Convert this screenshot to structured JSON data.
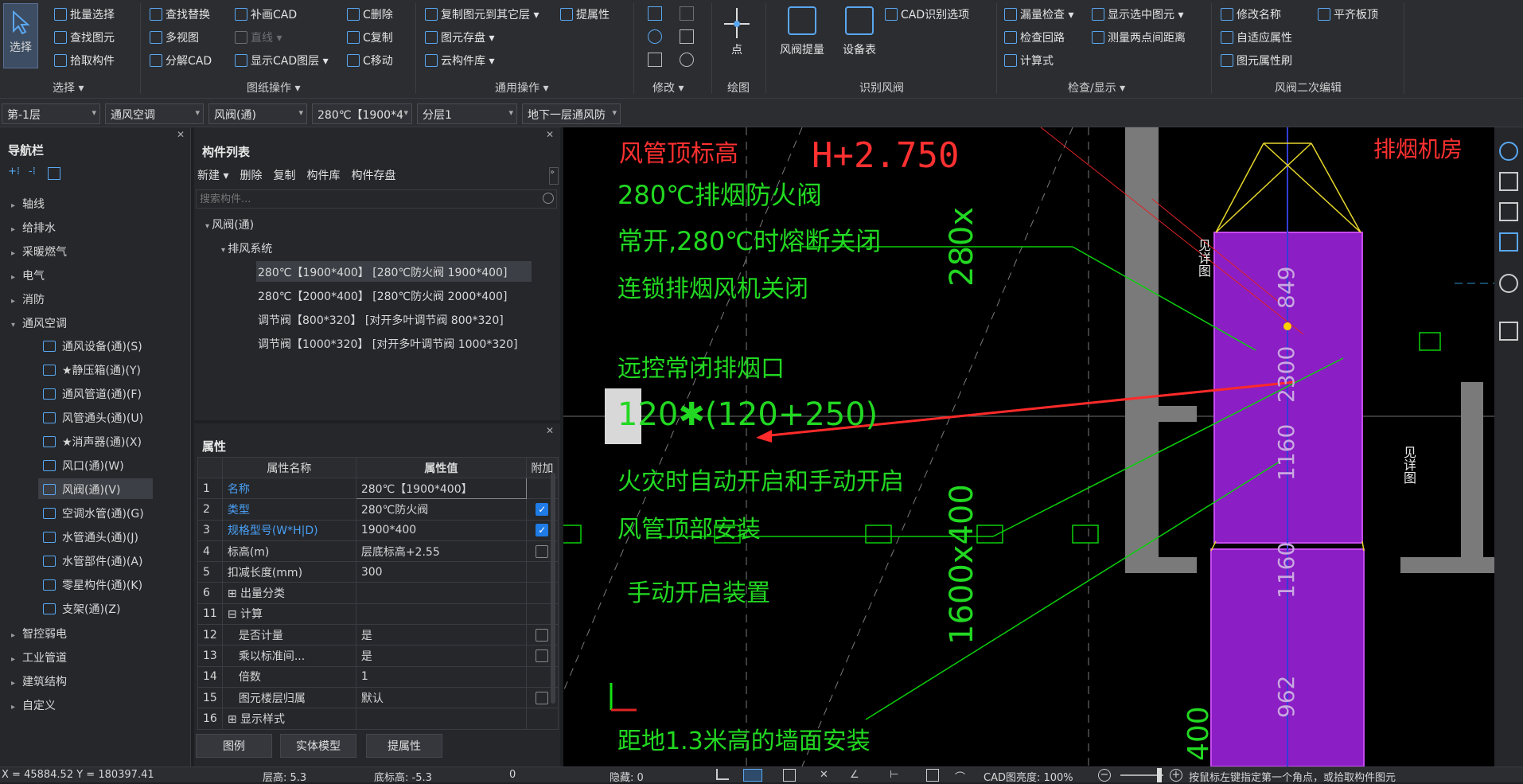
{
  "ribbon": {
    "select_label": "选择",
    "select_group": {
      "items": [
        "批量选择",
        "查找图元",
        "拾取构件"
      ],
      "label": "选择 ▾"
    },
    "drawing_group": {
      "col1": [
        "查找替换",
        "多视图",
        "分解CAD"
      ],
      "col2": [
        "补画CAD",
        "直线 ▾",
        "显示CAD图层 ▾"
      ],
      "col3": [
        "C删除",
        "C复制",
        "C移动"
      ],
      "label": "图纸操作 ▾"
    },
    "general_group": {
      "col1": [
        "复制图元到其它层 ▾",
        "图元存盘 ▾",
        "云构件库 ▾"
      ],
      "col2": [
        "提属性"
      ],
      "label": "通用操作 ▾"
    },
    "modify_group": {
      "label": "修改 ▾"
    },
    "draw_group": {
      "point_label": "点",
      "label": "绘图"
    },
    "recognize_group": {
      "valve_label": "风阀提量",
      "table_label": "设备表",
      "cad_option": "CAD识别选项",
      "label": "识别风阀"
    },
    "check_group": {
      "col1": [
        "漏量检查 ▾",
        "检查回路",
        "计算式"
      ],
      "col2": [
        "显示选中图元 ▾",
        "测量两点间距离"
      ],
      "label": "检查/显示 ▾"
    },
    "edit_group": {
      "col1": [
        "修改名称",
        "自适应属性",
        "图元属性刷"
      ],
      "col2": [
        "平齐板顶"
      ],
      "label": "风阀二次编辑"
    }
  },
  "toolbar": {
    "combos": [
      "第-1层",
      "通风空调",
      "风阀(通)",
      "280℃【1900*4",
      "分层1",
      "地下一层通风防"
    ]
  },
  "nav": {
    "title": "导航栏",
    "items_top": [
      "轴线",
      "给排水",
      "采暖燃气",
      "电气",
      "消防",
      "通风空调"
    ],
    "sub_items": [
      "通风设备(通)(S)",
      "★静压箱(通)(Y)",
      "通风管道(通)(F)",
      "风管通头(通)(U)",
      "★消声器(通)(X)",
      "风口(通)(W)",
      "风阀(通)(V)",
      "空调水管(通)(G)",
      "水管通头(通)(J)",
      "水管部件(通)(A)",
      "零星构件(通)(K)",
      "支架(通)(Z)"
    ],
    "items_bottom": [
      "智控弱电",
      "工业管道",
      "建筑结构",
      "自定义"
    ]
  },
  "complist": {
    "title": "构件列表",
    "tools": [
      "新建 ▾",
      "删除",
      "复制",
      "构件库",
      "构件存盘"
    ],
    "search_placeholder": "搜索构件...",
    "tree_root": "风阀(通)",
    "tree_group": "排风系统",
    "entries": [
      "280℃【1900*400】 [280℃防火阀 1900*400]",
      "280℃【2000*400】 [280℃防火阀 2000*400]",
      "调节阀【800*320】 [对开多叶调节阀 800*320]",
      "调节阀【1000*320】 [对开多叶调节阀 1000*320]"
    ]
  },
  "props": {
    "title": "属性",
    "headers": [
      "属性名称",
      "属性值",
      "附加"
    ],
    "rows": [
      {
        "no": "1",
        "name": "名称",
        "value": "280℃【1900*400】",
        "chk": "none",
        "blue": true
      },
      {
        "no": "2",
        "name": "类型",
        "value": "280℃防火阀",
        "chk": "on",
        "blue": true
      },
      {
        "no": "3",
        "name": "规格型号(W*H|D)",
        "value": "1900*400",
        "chk": "on",
        "blue": true
      },
      {
        "no": "4",
        "name": "标高(m)",
        "value": "层底标高+2.55",
        "chk": "off",
        "blue": false
      },
      {
        "no": "5",
        "name": "扣减长度(mm)",
        "value": "300",
        "chk": "none",
        "blue": false
      },
      {
        "no": "6",
        "name": "⊞ 出量分类",
        "value": "",
        "chk": "none",
        "blue": false
      },
      {
        "no": "11",
        "name": "⊟ 计算",
        "value": "",
        "chk": "none",
        "blue": false
      },
      {
        "no": "12",
        "name": "　是否计量",
        "value": "是",
        "chk": "off",
        "blue": false
      },
      {
        "no": "13",
        "name": "　乘以标准间...",
        "value": "是",
        "chk": "off",
        "blue": false
      },
      {
        "no": "14",
        "name": "　倍数",
        "value": "1",
        "chk": "none",
        "blue": false
      },
      {
        "no": "15",
        "name": "　图元楼层归属",
        "value": "默认",
        "chk": "off",
        "blue": false
      },
      {
        "no": "16",
        "name": "⊞ 显示样式",
        "value": "",
        "chk": "none",
        "blue": false
      }
    ],
    "tabs": [
      "图例",
      "实体模型",
      "提属性"
    ]
  },
  "canvas": {
    "elev_label": "风管顶标高",
    "elev_value": "H+2.750",
    "lines": [
      "280℃排烟防火阀",
      "常开,280℃时熔断关闭",
      "连锁排烟风机关闭",
      "远控常闭排烟口",
      "120✱(120+250)",
      "火灾时自动开启和手动开启",
      "风管顶部安装",
      "手动开启装置",
      "距地1.3米高的墙面安装"
    ],
    "dims": [
      "280x",
      "1600x400",
      "1160",
      "1160",
      "962",
      "849",
      "2300",
      "400"
    ],
    "fan_label": "排烟机房",
    "vert_label1": "见详图",
    "vert_label2": "见详图"
  },
  "status": {
    "coords": "X = 45884.52 Y = 180397.41",
    "floor_h": "层高: 5.3",
    "base_h": "底标高: -5.3",
    "zero": "0",
    "hidden": "隐藏: 0",
    "brightness": "CAD图亮度: 100%",
    "hint": "按鼠标左键指定第一个角点，或拾取构件图元"
  }
}
